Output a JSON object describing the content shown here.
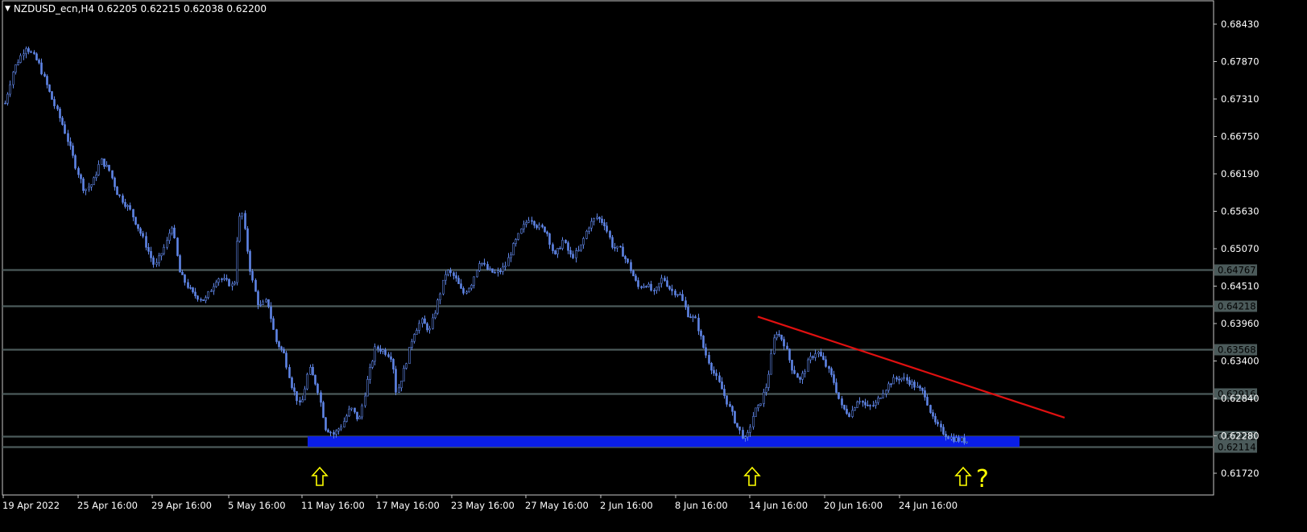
{
  "header": {
    "menu_icon": "triangle-down-icon",
    "symbol_timeframe": "NZDUSD_ecn,H4",
    "ohlc": "0.62205 0.62215 0.62038 0.62200"
  },
  "chart_data": {
    "type": "candlestick",
    "title": "NZDUSD_ecn,H4",
    "y_ticks": [
      "0.68430",
      "0.67870",
      "0.67310",
      "0.66750",
      "0.66190",
      "0.65630",
      "0.65070",
      "0.64510",
      "0.63960",
      "0.63400",
      "0.62840",
      "0.62280",
      "0.61720"
    ],
    "y_range": [
      0.6157,
      0.6873
    ],
    "x_ticks": [
      "19 Apr 2022",
      "25 Apr 16:00",
      "29 Apr 16:00",
      "5 May 16:00",
      "11 May 16:00",
      "17 May 16:00",
      "23 May 16:00",
      "27 May 16:00",
      "2 Jun 16:00",
      "8 Jun 16:00",
      "14 Jun 16:00",
      "20 Jun 16:00",
      "24 Jun 16:00"
    ],
    "horizontal_levels": [
      {
        "price": 0.64767,
        "label": "0.64767"
      },
      {
        "price": 0.64218,
        "label": "0.64218"
      },
      {
        "price": 0.63568,
        "label": "0.63568"
      },
      {
        "price": 0.62916,
        "label": "0.62916"
      },
      {
        "price": 0.62272,
        "label": "0.62272"
      },
      {
        "price": 0.62114,
        "label": "0.62114"
      }
    ],
    "support_zone": {
      "from": 0.62114,
      "to": 0.62272,
      "color": "#0a1ee6"
    },
    "trendline": {
      "color": "#e01010",
      "from_price": 0.6406,
      "to_price": 0.6255,
      "from_date": "13 Jun",
      "to_date": "26 Jun"
    },
    "annotations": [
      {
        "icon": "up-arrow-icon",
        "near": "11 May 16:00"
      },
      {
        "icon": "up-arrow-icon",
        "near": "14 Jun 16:00"
      },
      {
        "icon": "up-arrow-icon",
        "near": "24 Jun 16:00",
        "suffix": "?"
      }
    ],
    "path_points": [
      [
        0.6725,
        0
      ],
      [
        0.6775,
        2
      ],
      [
        0.681,
        5
      ],
      [
        0.6785,
        8
      ],
      [
        0.6735,
        11
      ],
      [
        0.669,
        14
      ],
      [
        0.663,
        17
      ],
      [
        0.6595,
        19
      ],
      [
        0.6605,
        21
      ],
      [
        0.664,
        23
      ],
      [
        0.6625,
        25
      ],
      [
        0.659,
        27
      ],
      [
        0.6565,
        30
      ],
      [
        0.6525,
        33
      ],
      [
        0.648,
        36
      ],
      [
        0.652,
        39
      ],
      [
        0.6545,
        40
      ],
      [
        0.647,
        42
      ],
      [
        0.644,
        45
      ],
      [
        0.643,
        48
      ],
      [
        0.6465,
        51
      ],
      [
        0.6455,
        54
      ],
      [
        0.645,
        55
      ],
      [
        0.655,
        56
      ],
      [
        0.656,
        57
      ],
      [
        0.647,
        59
      ],
      [
        0.642,
        61
      ],
      [
        0.643,
        63
      ],
      [
        0.637,
        65
      ],
      [
        0.635,
        67
      ],
      [
        0.63,
        69
      ],
      [
        0.627,
        71
      ],
      [
        0.633,
        73
      ],
      [
        0.63,
        75
      ],
      [
        0.624,
        77
      ],
      [
        0.623,
        79
      ],
      [
        0.6245,
        81
      ],
      [
        0.627,
        83
      ],
      [
        0.625,
        85
      ],
      [
        0.631,
        87
      ],
      [
        0.636,
        89
      ],
      [
        0.6355,
        91
      ],
      [
        0.6345,
        93
      ],
      [
        0.629,
        94
      ],
      [
        0.633,
        96
      ],
      [
        0.638,
        98
      ],
      [
        0.64,
        100
      ],
      [
        0.6385,
        102
      ],
      [
        0.643,
        104
      ],
      [
        0.6475,
        106
      ],
      [
        0.6465,
        108
      ],
      [
        0.644,
        110
      ],
      [
        0.6455,
        112
      ],
      [
        0.649,
        114
      ],
      [
        0.6475,
        116
      ],
      [
        0.647,
        118
      ],
      [
        0.648,
        120
      ],
      [
        0.651,
        122
      ],
      [
        0.6535,
        124
      ],
      [
        0.6555,
        126
      ],
      [
        0.654,
        128
      ],
      [
        0.6535,
        130
      ],
      [
        0.6495,
        132
      ],
      [
        0.652,
        134
      ],
      [
        0.6495,
        136
      ],
      [
        0.6505,
        138
      ],
      [
        0.654,
        140
      ],
      [
        0.6555,
        142
      ],
      [
        0.6545,
        144
      ],
      [
        0.651,
        146
      ],
      [
        0.6505,
        148
      ],
      [
        0.648,
        150
      ],
      [
        0.645,
        152
      ],
      [
        0.6455,
        154
      ],
      [
        0.644,
        156
      ],
      [
        0.6465,
        158
      ],
      [
        0.6445,
        160
      ],
      [
        0.644,
        162
      ],
      [
        0.641,
        164
      ],
      [
        0.64,
        166
      ],
      [
        0.6355,
        168
      ],
      [
        0.6325,
        170
      ],
      [
        0.63,
        172
      ],
      [
        0.627,
        174
      ],
      [
        0.624,
        176
      ],
      [
        0.622,
        178
      ],
      [
        0.6265,
        180
      ],
      [
        0.627,
        181
      ],
      [
        0.6305,
        183
      ],
      [
        0.6385,
        185
      ],
      [
        0.637,
        187
      ],
      [
        0.633,
        189
      ],
      [
        0.631,
        191
      ],
      [
        0.634,
        193
      ],
      [
        0.6355,
        195
      ],
      [
        0.6335,
        197
      ],
      [
        0.631,
        199
      ],
      [
        0.627,
        201
      ],
      [
        0.626,
        203
      ],
      [
        0.6285,
        205
      ],
      [
        0.627,
        207
      ],
      [
        0.6275,
        209
      ],
      [
        0.6295,
        211
      ],
      [
        0.631,
        213
      ],
      [
        0.6315,
        215
      ],
      [
        0.631,
        217
      ],
      [
        0.63,
        219
      ],
      [
        0.629,
        221
      ],
      [
        0.625,
        223
      ],
      [
        0.6235,
        225
      ],
      [
        0.6225,
        227
      ],
      [
        0.6222,
        229
      ],
      [
        0.622,
        231
      ]
    ]
  }
}
